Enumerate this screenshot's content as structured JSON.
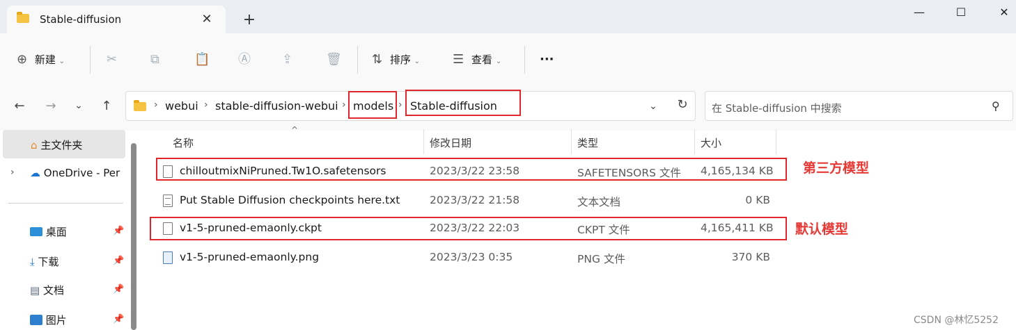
{
  "window": {
    "tab_title": "Stable-diffusion",
    "tab_close": "✕",
    "new_tab": "+",
    "minimize": "—",
    "maximize": "☐",
    "close": "✕"
  },
  "toolbar": {
    "new_label": "新建",
    "sort_label": "排序",
    "view_label": "查看",
    "more_label": "···",
    "dropdown_caret": "⌄"
  },
  "navigation": {
    "back": "←",
    "forward": "→",
    "recent": "⌄",
    "up": "↑",
    "breadcrumbs": [
      "webui",
      "stable-diffusion-webui",
      "models",
      "Stable-diffusion"
    ],
    "crumb_sep": "›",
    "address_dropdown": "⌄",
    "refresh": "↻",
    "search_placeholder": "在 Stable-diffusion 中搜索",
    "search_icon": "⚲"
  },
  "sidebar": {
    "items": [
      {
        "label": "主文件夹",
        "icon": "home-icon"
      },
      {
        "label": "OneDrive - Per",
        "icon": "cloud-icon",
        "expander": "›"
      },
      {
        "label": "桌面",
        "icon": "desktop-icon",
        "pinned": true
      },
      {
        "label": "下载",
        "icon": "download-icon",
        "pinned": true
      },
      {
        "label": "文档",
        "icon": "document-icon",
        "pinned": true
      },
      {
        "label": "图片",
        "icon": "pictures-icon",
        "pinned": true
      }
    ],
    "pin_glyph": "📌"
  },
  "columns": {
    "name": "名称",
    "date": "修改日期",
    "type": "类型",
    "size": "大小",
    "sort_caret": "^"
  },
  "files": [
    {
      "name": "chilloutmixNiPruned.Tw1O.safetensors",
      "date": "2023/3/22 23:58",
      "type": "SAFETENSORS 文件",
      "size": "4,165,134 KB",
      "icon": "file-icon"
    },
    {
      "name": "Put Stable Diffusion checkpoints here.txt",
      "date": "2023/3/22 21:58",
      "type": "文本文档",
      "size": "0 KB",
      "icon": "text-file-icon"
    },
    {
      "name": "v1-5-pruned-emaonly.ckpt",
      "date": "2023/3/22 22:03",
      "type": "CKPT 文件",
      "size": "4,165,411 KB",
      "icon": "file-icon"
    },
    {
      "name": "v1-5-pruned-emaonly.png",
      "date": "2023/3/23 0:35",
      "type": "PNG 文件",
      "size": "370 KB",
      "icon": "image-file-icon"
    }
  ],
  "annotations": {
    "third_party": "第三方模型",
    "default": "默认模型",
    "color": "#e53935"
  },
  "watermark": "CSDN @林忆5252"
}
